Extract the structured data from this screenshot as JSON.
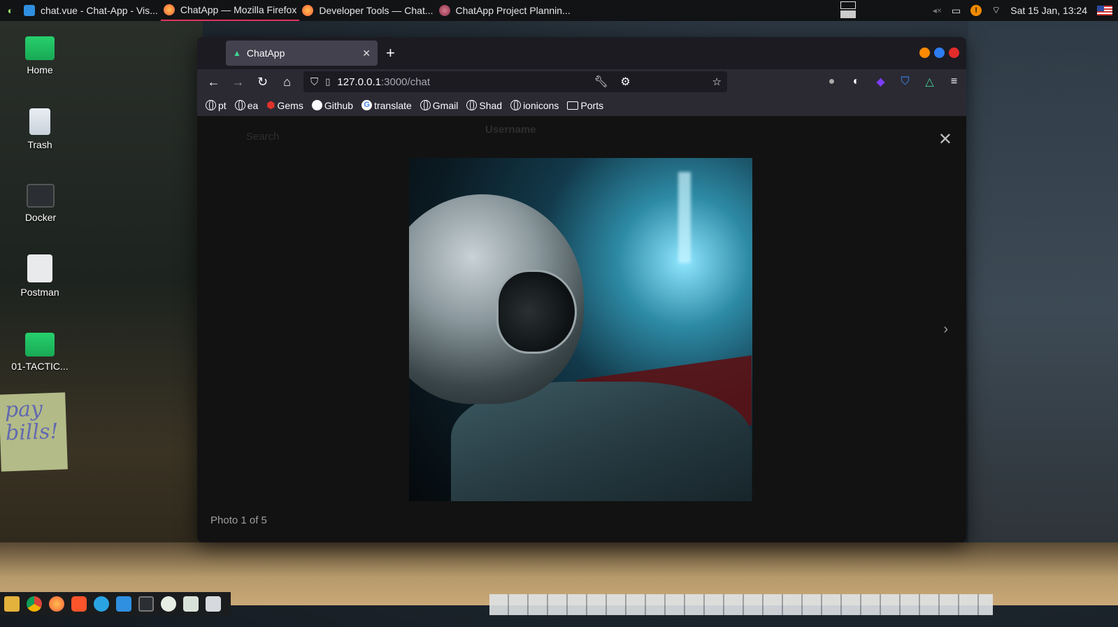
{
  "top_panel": {
    "tasks": [
      {
        "label": "chat.vue - Chat-App - Vis...",
        "icon": "vscode-icon",
        "color": "#2f8fe0"
      },
      {
        "label": "ChatApp — Mozilla Firefox",
        "icon": "firefox-icon",
        "color": "#ff7139",
        "active": true
      },
      {
        "label": "Developer Tools — Chat...",
        "icon": "firefox-icon",
        "color": "#ff7139"
      },
      {
        "label": "ChatApp Project Plannin...",
        "icon": "firefox-icon",
        "color": "#b04a63"
      }
    ],
    "clock": "Sat 15 Jan, 13:24"
  },
  "desktop": {
    "icons": [
      {
        "label": "Home",
        "icon": "home-folder-icon"
      },
      {
        "label": "Trash",
        "icon": "trash-icon"
      },
      {
        "label": "Docker",
        "icon": "terminal-icon"
      },
      {
        "label": "Postman",
        "icon": "postman-icon"
      },
      {
        "label": "01-TACTIC...",
        "icon": "folder-icon"
      }
    ],
    "note_text": "pay bills!"
  },
  "browser": {
    "tab": {
      "label": "ChatApp",
      "close": "✕"
    },
    "new_tab": "+",
    "url": {
      "host": "127.0.0.1",
      "path": ":3000/chat"
    },
    "bookmarks": [
      {
        "label": "pt",
        "icon": "globe-icon"
      },
      {
        "label": "ea",
        "icon": "globe-icon"
      },
      {
        "label": "Gems",
        "icon": "gems-icon"
      },
      {
        "label": "Github",
        "icon": "github-icon"
      },
      {
        "label": "translate",
        "icon": "google-icon"
      },
      {
        "label": "Gmail",
        "icon": "globe-icon"
      },
      {
        "label": "Shad",
        "icon": "globe-icon"
      },
      {
        "label": "ionicons",
        "icon": "globe-icon"
      },
      {
        "label": "Ports",
        "icon": "folder-icon"
      }
    ]
  },
  "page": {
    "bg_search": "Search",
    "bg_username": "Username",
    "lightbox": {
      "caption": "Photo 1 of 5",
      "close": "✕",
      "next": "›"
    }
  },
  "colors": {
    "accent_vue": "#42d392",
    "close_red": "#e22b2b",
    "min_orange": "#ff8a00",
    "max_blue": "#1a73e8"
  }
}
